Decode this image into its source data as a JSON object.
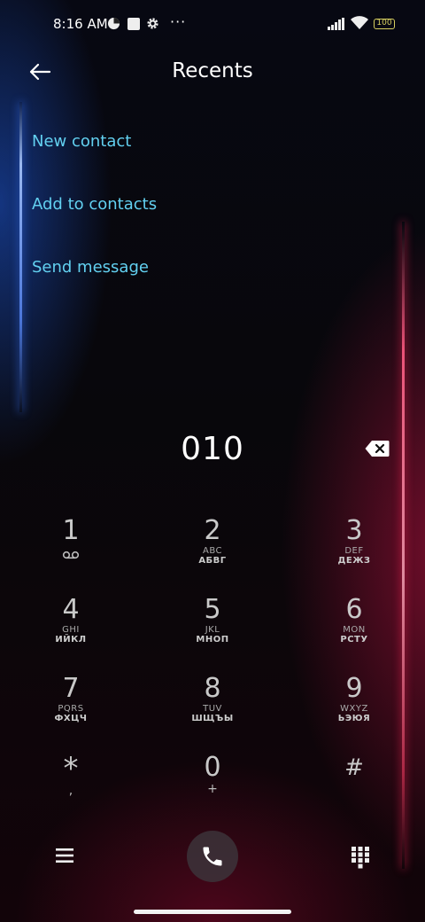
{
  "status_bar": {
    "time": "8:16 AM",
    "more": "···",
    "battery": "100",
    "icons": [
      "pie-icon",
      "square-icon",
      "gear-icon",
      "signal-icon",
      "wifi-icon",
      "battery-icon"
    ]
  },
  "header": {
    "title": "Recents",
    "back_icon": "arrow-left-icon"
  },
  "actions": [
    {
      "label": "New contact"
    },
    {
      "label": "Add to contacts"
    },
    {
      "label": "Send message"
    }
  ],
  "dialed_number": "010",
  "keypad": [
    {
      "digit": "1",
      "lat": "",
      "cyr": "",
      "icon": "voicemail-icon"
    },
    {
      "digit": "2",
      "lat": "ABC",
      "cyr": "АБВГ"
    },
    {
      "digit": "3",
      "lat": "DEF",
      "cyr": "ДЕЖЗ"
    },
    {
      "digit": "4",
      "lat": "GHI",
      "cyr": "ИЙКЛ"
    },
    {
      "digit": "5",
      "lat": "JKL",
      "cyr": "МНОП"
    },
    {
      "digit": "6",
      "lat": "MON",
      "cyr": "РСТУ"
    },
    {
      "digit": "7",
      "lat": "PQRS",
      "cyr": "ФХЦЧ"
    },
    {
      "digit": "8",
      "lat": "TUV",
      "cyr": "ШЩЪЫ"
    },
    {
      "digit": "9",
      "lat": "WXYZ",
      "cyr": "ЬЭЮЯ"
    },
    {
      "digit": "*",
      "lat": ",",
      "cyr": ""
    },
    {
      "digit": "0",
      "lat": "+",
      "cyr": ""
    },
    {
      "digit": "#",
      "lat": "",
      "cyr": ""
    }
  ],
  "colors": {
    "accent": "#62d0f0",
    "call_button": "#3c343a"
  }
}
